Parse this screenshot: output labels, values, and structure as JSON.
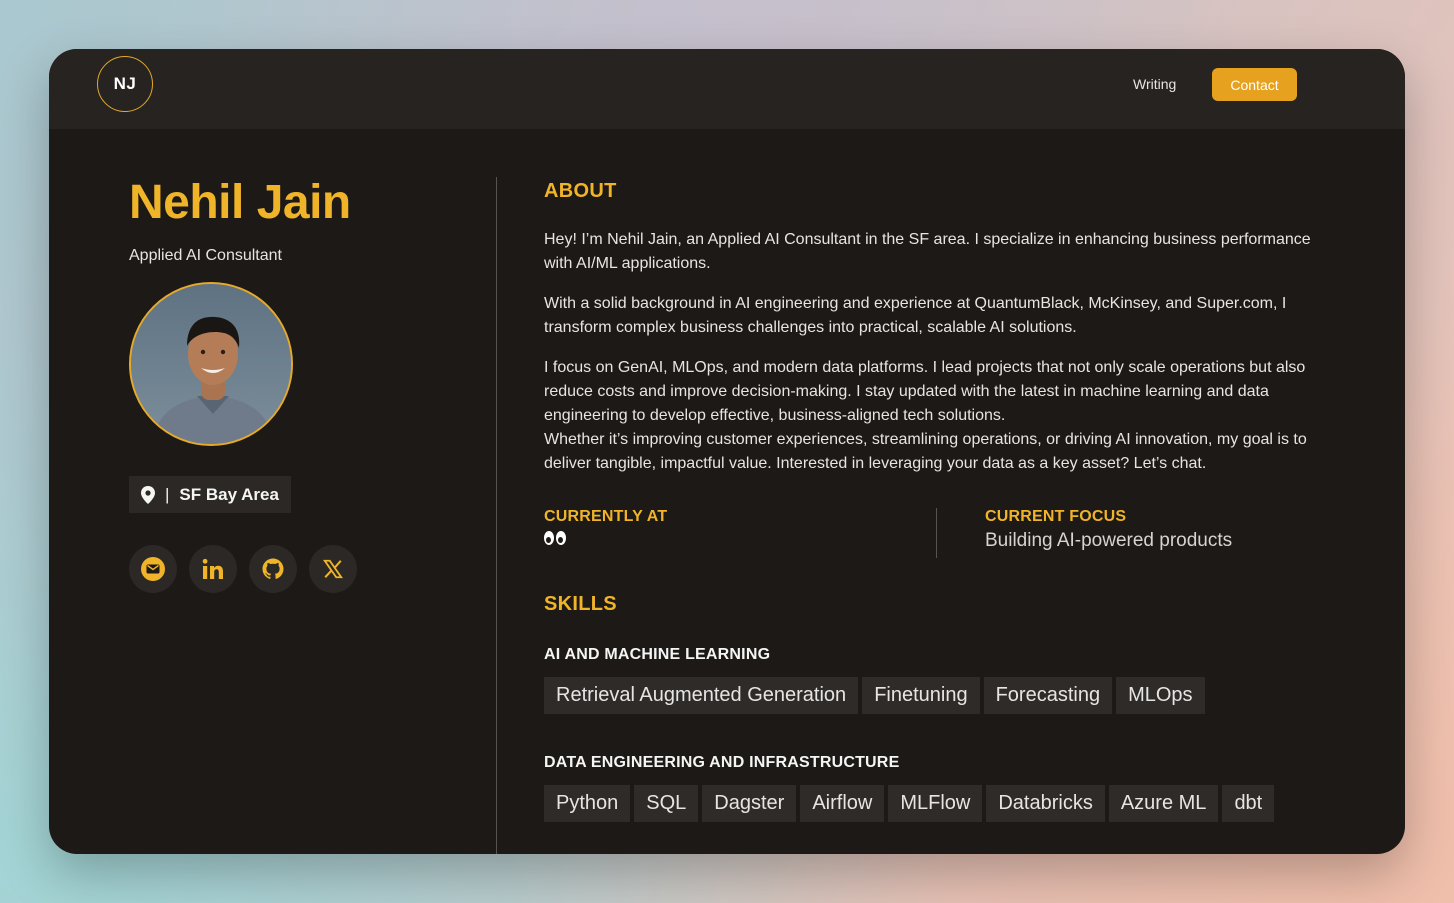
{
  "nav": {
    "logo": "NJ",
    "writing": "Writing",
    "contact": "Contact"
  },
  "profile": {
    "name": "Nehil Jain",
    "role": "Applied AI Consultant",
    "location": "SF Bay Area",
    "location_sep": "|",
    "socials": [
      "email-icon",
      "linkedin-icon",
      "github-icon",
      "x-icon"
    ]
  },
  "about": {
    "title": "ABOUT",
    "p1": "Hey! I’m Nehil Jain, an Applied AI Consultant in the SF area. I specialize in enhancing business performance with AI/ML applications.",
    "p2": "With a solid background in AI engineering and experience at QuantumBlack, McKinsey, and Super.com, I transform complex business challenges into practical, scalable AI solutions.",
    "p3": "I focus on GenAI, MLOps, and modern data platforms. I lead projects that not only scale operations but also reduce costs and improve decision-making. I stay updated with the latest in machine learning and data engineering to develop effective, business-aligned tech solutions.",
    "p4": "Whether it’s improving customer experiences, streamlining operations, or driving AI innovation, my goal is to deliver tangible, impactful value. Interested in leveraging your data as a key asset? Let’s chat."
  },
  "facts": {
    "current_label": "CURRENTLY AT",
    "focus_label": "CURRENT FOCUS",
    "focus_value": "Building AI-powered products"
  },
  "skills": {
    "title": "SKILLS",
    "groups": [
      {
        "name": "AI AND MACHINE LEARNING",
        "items": [
          "Retrieval Augmented Generation",
          "Finetuning",
          "Forecasting",
          "MLOps"
        ]
      },
      {
        "name": "DATA ENGINEERING AND INFRASTRUCTURE",
        "items": [
          "Python",
          "SQL",
          "Dagster",
          "Airflow",
          "MLFlow",
          "Databricks",
          "Azure ML",
          "dbt"
        ]
      }
    ]
  },
  "colors": {
    "accent": "#f0b429",
    "button": "#e6a11f",
    "panel": "#1c1917"
  }
}
